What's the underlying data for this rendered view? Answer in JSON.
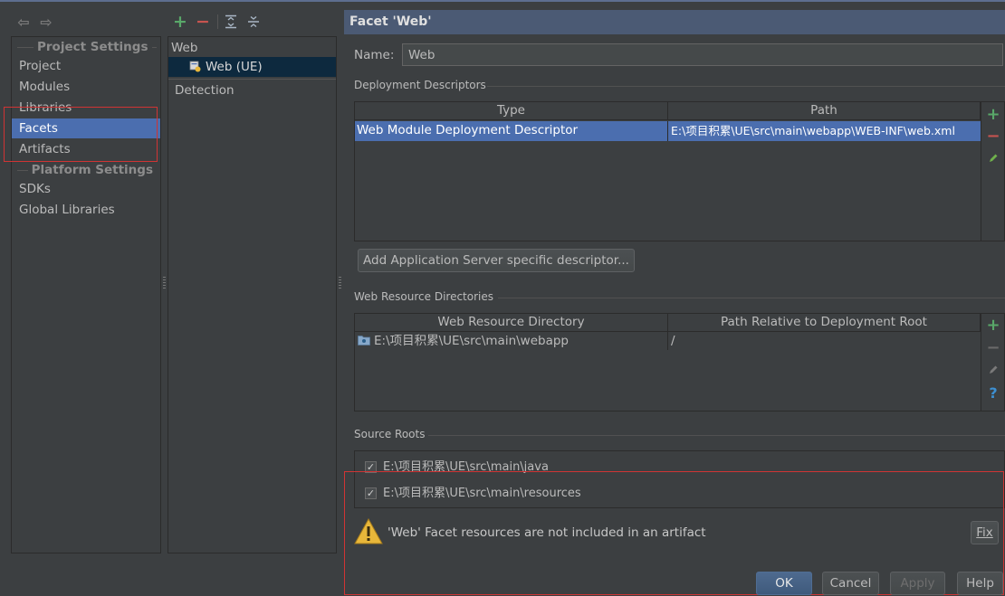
{
  "nav": {
    "back_icon": "arrow-left-icon",
    "forward_icon": "arrow-right-icon",
    "project_settings_header": "Project Settings",
    "project_items": [
      "Project",
      "Modules",
      "Libraries",
      "Facets",
      "Artifacts"
    ],
    "selected_item": "Facets",
    "platform_settings_header": "Platform Settings",
    "platform_items": [
      "SDKs",
      "Global Libraries"
    ]
  },
  "tree": {
    "toolbar_icons": [
      "add-icon",
      "remove-icon",
      "expand-all-icon",
      "collapse-all-icon"
    ],
    "root_label": "Web",
    "child_label": "Web (UE)",
    "detection_label": "Detection"
  },
  "facet": {
    "header_title": "Facet 'Web'",
    "name_label": "Name:",
    "name_value": "Web",
    "deployment": {
      "group_title": "Deployment Descriptors",
      "columns": [
        "Type",
        "Path"
      ],
      "rows": [
        {
          "type": "Web Module Deployment Descriptor",
          "path": "E:\\项目积累\\UE\\src\\main\\webapp\\WEB-INF\\web.xml"
        }
      ],
      "add_server_button": "Add Application Server specific descriptor..."
    },
    "resources": {
      "group_title": "Web Resource Directories",
      "columns": [
        "Web Resource Directory",
        "Path Relative to Deployment Root"
      ],
      "rows": [
        {
          "directory": "E:\\项目积累\\UE\\src\\main\\webapp",
          "relative": "/"
        }
      ]
    },
    "source_roots": {
      "group_title": "Source Roots",
      "items": [
        {
          "label": "E:\\项目积累\\UE\\src\\main\\java",
          "checked": true
        },
        {
          "label": "E:\\项目积累\\UE\\src\\main\\resources",
          "checked": true
        }
      ]
    },
    "warning": {
      "text": "'Web' Facet resources are not included in an artifact",
      "fix_button": "Fix"
    }
  },
  "footer": {
    "ok": "OK",
    "cancel": "Cancel",
    "apply": "Apply",
    "help": "Help"
  },
  "colors": {
    "background": "#3c3f41",
    "selection": "#4b6eaf",
    "header_bar": "#4b5a74",
    "add_green": "#59a869",
    "remove_red": "#c75450",
    "highlight_red": "#d03434",
    "warning_yellow": "#e8b73a"
  }
}
